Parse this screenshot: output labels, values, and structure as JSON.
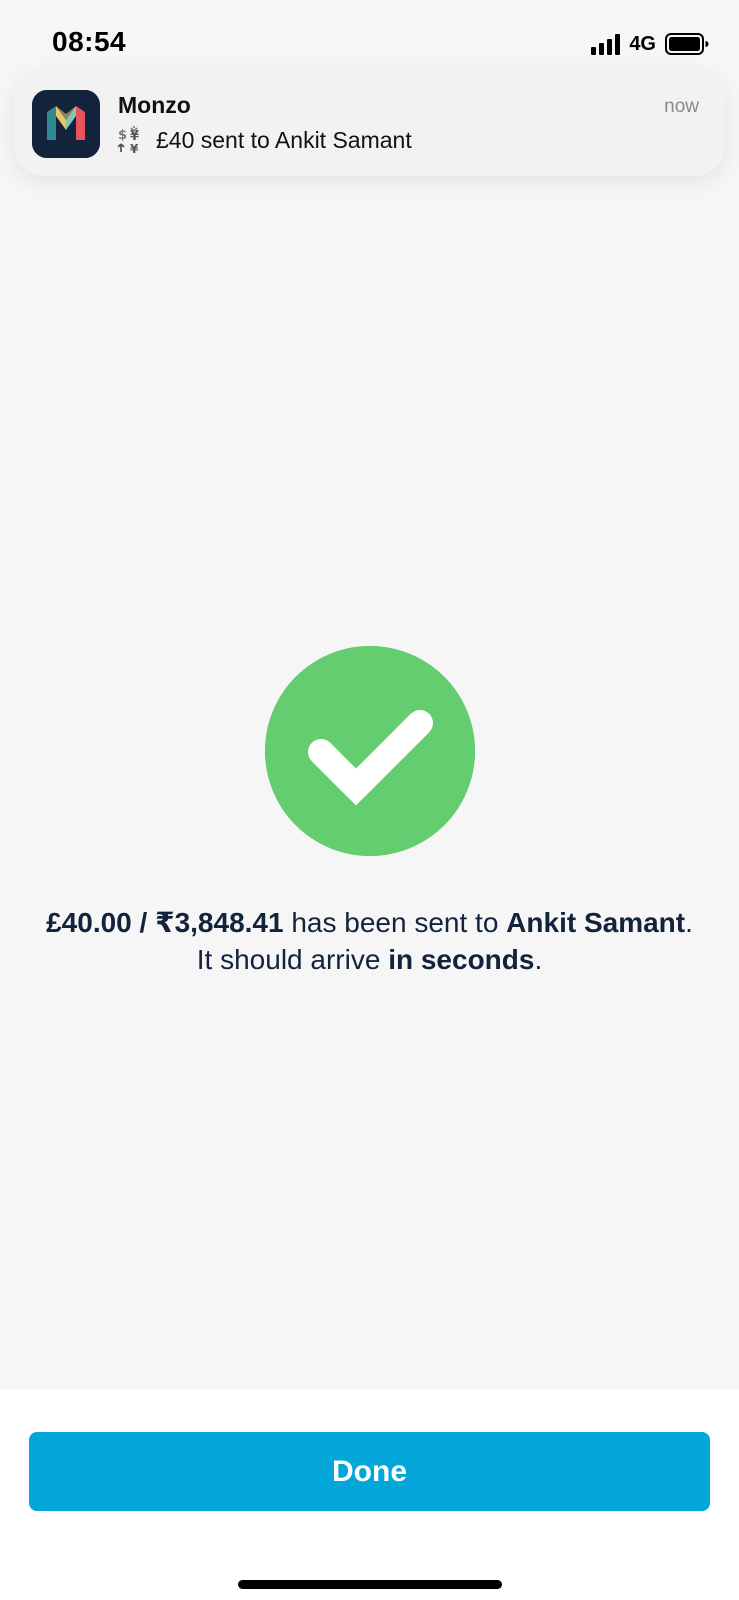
{
  "status_bar": {
    "time": "08:54",
    "network": "4G",
    "icons": [
      "signal-icon",
      "battery-icon"
    ]
  },
  "notification": {
    "app_name": "Monzo",
    "time": "now",
    "message": "£40 sent to Ankit Samant",
    "icons": [
      "monzo-app-icon",
      "currency-exchange-icon"
    ]
  },
  "success": {
    "icon": "checkmark-icon",
    "amount": "£40.00 / ₹3,848.41",
    "text_1": " has been sent to ",
    "recipient": "Ankit Samant",
    "text_2": ". It should arrive ",
    "eta": "in seconds",
    "text_3": "."
  },
  "actions": {
    "done_label": "Done"
  },
  "colors": {
    "success_green": "#63cd70",
    "button_blue": "#03a6d9",
    "text_navy": "#14233c",
    "background": "#f6f6f6"
  }
}
